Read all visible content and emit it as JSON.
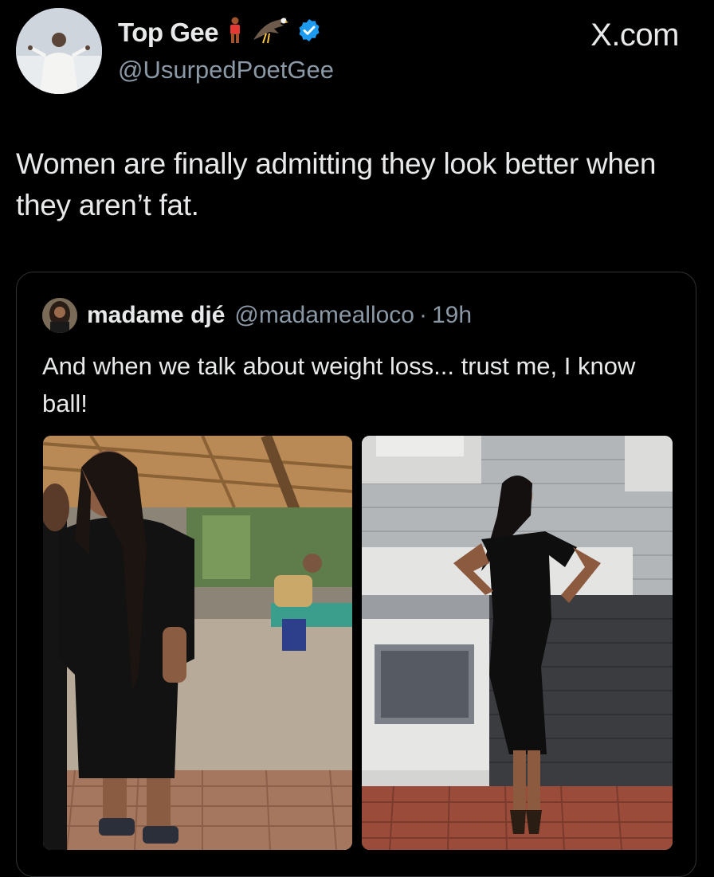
{
  "header": {
    "display_name": "Top Gee",
    "handle": "@UsurpedPoetGee",
    "brand": "X.com",
    "emoji_icons": [
      "person-standing-icon",
      "eagle-icon"
    ],
    "verified_icon": "verified-badge-icon"
  },
  "tweet": {
    "text": "Women are finally admitting they look better when they aren’t fat."
  },
  "quoted_tweet": {
    "display_name": "madame djé",
    "handle": "@madamealloco",
    "separator": "·",
    "time": "19h",
    "text": "And when we talk about weight loss... trust me, I know ball!",
    "images": [
      "before-photo",
      "after-photo"
    ]
  },
  "colors": {
    "background": "#000000",
    "text": "#e7e9ea",
    "secondary": "#8b98a5",
    "verified": "#1d9bf0",
    "border": "#2f3336"
  }
}
